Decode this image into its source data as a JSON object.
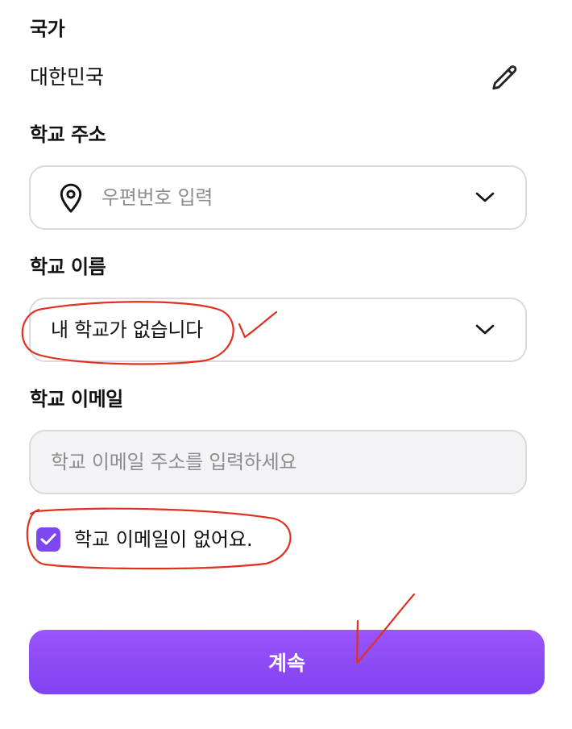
{
  "country": {
    "label": "국가",
    "value": "대한민국",
    "edit_icon": "pencil-icon"
  },
  "school_address": {
    "label": "학교 주소",
    "placeholder": "우편번호 입력",
    "leading_icon": "map-pin-icon",
    "trailing_icon": "chevron-down-icon"
  },
  "school_name": {
    "label": "학교 이름",
    "value": "내 학교가 없습니다",
    "trailing_icon": "chevron-down-icon"
  },
  "school_email": {
    "label": "학교 이메일",
    "placeholder": "학교 이메일 주소를 입력하세요"
  },
  "no_email_checkbox": {
    "label": "학교 이메일이 없어요.",
    "checked": true
  },
  "continue_button": {
    "label": "계속"
  },
  "colors": {
    "accent": "#7d48f0",
    "button_top": "#9a55fb",
    "button_bottom": "#8142f0",
    "annotation_red": "#e03020",
    "border": "#d9d9de",
    "placeholder": "#8c8c94"
  }
}
